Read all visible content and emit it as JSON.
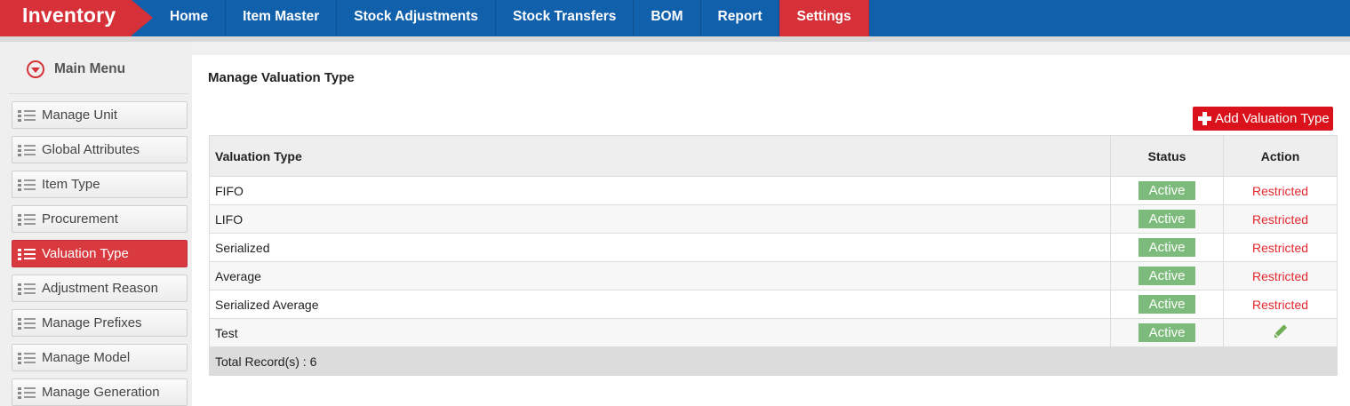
{
  "header": {
    "brand": "Inventory",
    "nav": [
      {
        "label": "Home",
        "active": false
      },
      {
        "label": "Item Master",
        "active": false
      },
      {
        "label": "Stock Adjustments",
        "active": false
      },
      {
        "label": "Stock Transfers",
        "active": false
      },
      {
        "label": "BOM",
        "active": false
      },
      {
        "label": "Report",
        "active": false
      },
      {
        "label": "Settings",
        "active": true
      }
    ]
  },
  "sidebar": {
    "title": "Main Menu",
    "title_icon": "chevron-down-circle-icon",
    "items": [
      {
        "label": "Manage Unit",
        "active": false
      },
      {
        "label": "Global Attributes",
        "active": false
      },
      {
        "label": "Item Type",
        "active": false
      },
      {
        "label": "Procurement",
        "active": false
      },
      {
        "label": "Valuation Type",
        "active": true
      },
      {
        "label": "Adjustment Reason",
        "active": false
      },
      {
        "label": "Manage Prefixes",
        "active": false
      },
      {
        "label": "Manage Model",
        "active": false
      },
      {
        "label": "Manage Generation",
        "active": false
      }
    ]
  },
  "main": {
    "title": "Manage Valuation Type",
    "add_button": "Add Valuation Type",
    "table": {
      "columns": [
        "Valuation Type",
        "Status",
        "Action"
      ],
      "rows": [
        {
          "type": "FIFO",
          "status": "Active",
          "action": "Restricted"
        },
        {
          "type": "LIFO",
          "status": "Active",
          "action": "Restricted"
        },
        {
          "type": "Serialized",
          "status": "Active",
          "action": "Restricted"
        },
        {
          "type": "Average",
          "status": "Active",
          "action": "Restricted"
        },
        {
          "type": "Serialized Average",
          "status": "Active",
          "action": "Restricted"
        },
        {
          "type": "Test",
          "status": "Active",
          "action": "edit",
          "action_icon": "pencil-icon"
        }
      ],
      "footer": "Total Record(s) :  6"
    }
  },
  "colors": {
    "nav_bg": "#1060ac",
    "accent_red": "#d63038",
    "button_red": "#d9121b",
    "active_badge": "#7dbb7d",
    "restricted_text": "#e0282e"
  }
}
